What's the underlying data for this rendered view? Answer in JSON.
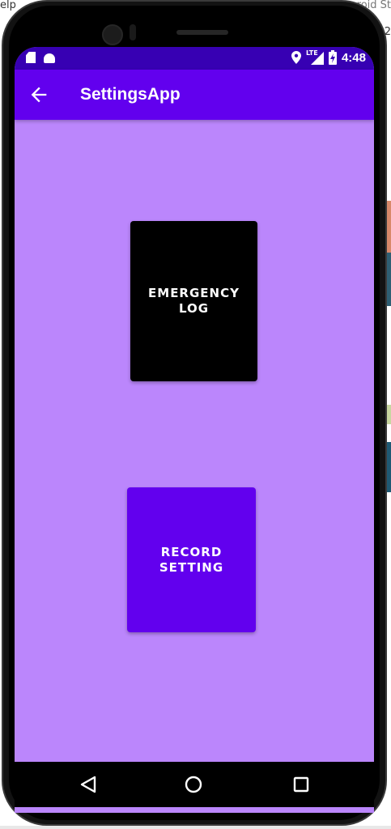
{
  "host": {
    "menu_fragment": "elp",
    "window_title_fragment": "roid St",
    "side_label_fragment": "2"
  },
  "status_bar": {
    "time": "4:48",
    "network": "LTE",
    "icons": [
      "sd-card-icon",
      "android-icon",
      "location-icon",
      "signal-icon",
      "battery-charging-icon"
    ]
  },
  "app_bar": {
    "title": "SettingsApp",
    "back_icon": "arrow-back-icon"
  },
  "buttons": {
    "emergency_log": "EMERGENCY\nLOG",
    "record_setting": "RECORD\nSETTING"
  },
  "nav_bar": {
    "icons": [
      "nav-back-icon",
      "nav-home-icon",
      "nav-recents-icon"
    ]
  },
  "colors": {
    "status_bar": "#3700b3",
    "app_bar": "#6200ee",
    "background": "#bb86fc",
    "emergency_button": "#000000",
    "record_button": "#6200ee"
  }
}
